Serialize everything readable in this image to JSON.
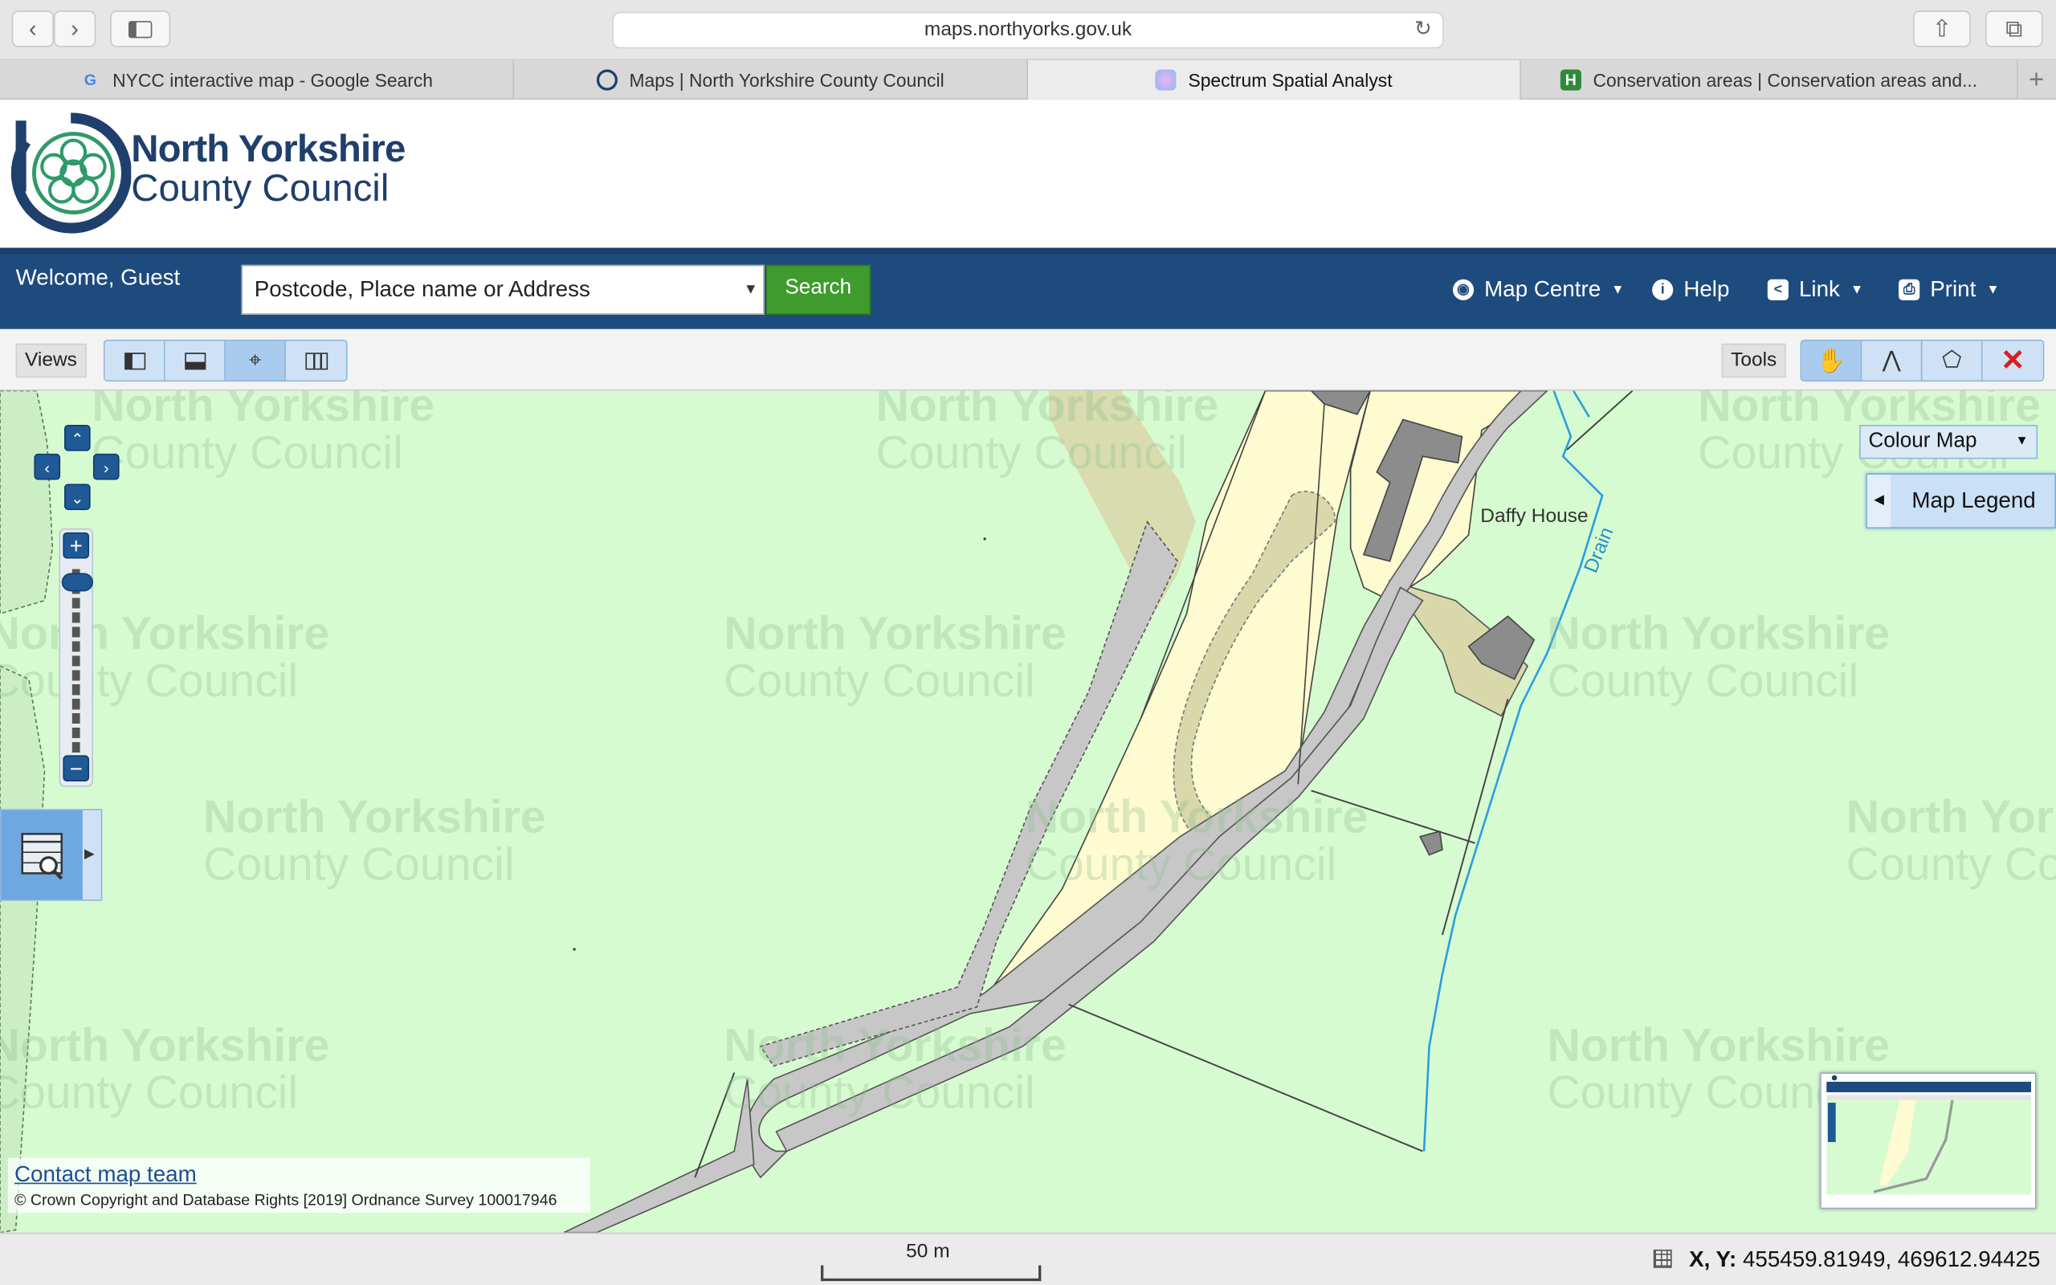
{
  "browser": {
    "url": "maps.northyorks.gov.uk",
    "tabs": [
      {
        "title": "NYCC interactive map - Google Search",
        "favicon": "google-icon",
        "active": false
      },
      {
        "title": "Maps | North Yorkshire County Council",
        "favicon": "nycc-icon",
        "active": false
      },
      {
        "title": "Spectrum Spatial Analyst",
        "favicon": "spectrum-icon",
        "active": true
      },
      {
        "title": "Conservation areas | Conservation areas and...",
        "favicon": "historic-england-icon",
        "active": false
      }
    ]
  },
  "header": {
    "logo_line1": "North Yorkshire",
    "logo_line2": "County Council"
  },
  "topnav": {
    "welcome": "Welcome, Guest",
    "search_placeholder": "Postcode, Place name or Address",
    "search_button": "Search",
    "map_centre": "Map Centre",
    "help": "Help",
    "link": "Link",
    "print": "Print"
  },
  "toolbar": {
    "views_label": "Views",
    "tools_label": "Tools"
  },
  "map": {
    "colour_map": "Colour Map",
    "map_legend": "Map Legend",
    "place_label": "Daffy House",
    "drain_label": "Drain",
    "watermark_line1": "North Yorkshire",
    "watermark_line2": "County Council",
    "contact_link": "Contact map team",
    "copyright": "© Crown Copyright and Database Rights [2019] Ordnance Survey 100017946"
  },
  "status": {
    "scale": "50 m",
    "coords_label": "X, Y:",
    "coords_value": "455459.81949, 469612.94425"
  },
  "colors": {
    "nav_blue": "#1e4b7e",
    "search_green": "#3f9b2c",
    "map_green": "#d7fbd1",
    "map_yellow": "#fffbd2",
    "road_gray": "#c8c8c8"
  }
}
